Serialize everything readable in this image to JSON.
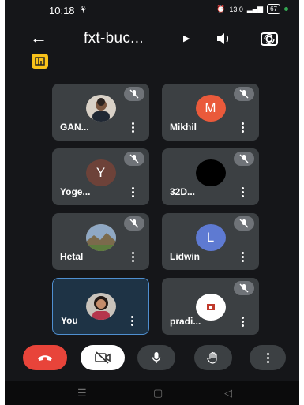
{
  "status_bar": {
    "time": "10:18",
    "network_speed": "13.0",
    "battery": "67"
  },
  "header": {
    "title": "fxt-buc..."
  },
  "participants": [
    {
      "name": "GAN...",
      "avatar_type": "photo",
      "muted": true
    },
    {
      "name": "Mikhil",
      "avatar_type": "initial",
      "initial": "M",
      "avatar_color": "#ea5a3b",
      "muted": true
    },
    {
      "name": "Yoge...",
      "avatar_type": "initial",
      "initial": "Y",
      "avatar_color": "#6d4239",
      "muted": true
    },
    {
      "name": "32D...",
      "avatar_type": "blank",
      "avatar_color": "#000000",
      "muted": true
    },
    {
      "name": "Hetal",
      "avatar_type": "photo",
      "muted": true
    },
    {
      "name": "Lidwin",
      "avatar_type": "initial",
      "initial": "L",
      "avatar_color": "#5e7ad2",
      "muted": true
    },
    {
      "name": "You",
      "avatar_type": "photo",
      "muted": false,
      "active": true
    },
    {
      "name": "pradi...",
      "avatar_type": "logo",
      "avatar_color": "#ffffff",
      "muted": true
    }
  ],
  "controls": [
    "end-call",
    "camera-off",
    "microphone",
    "raise-hand",
    "more-options"
  ],
  "colors": {
    "background": "#151619",
    "tile": "#3c4043",
    "end_call": "#e8443a",
    "badge": "#f9c21a"
  }
}
